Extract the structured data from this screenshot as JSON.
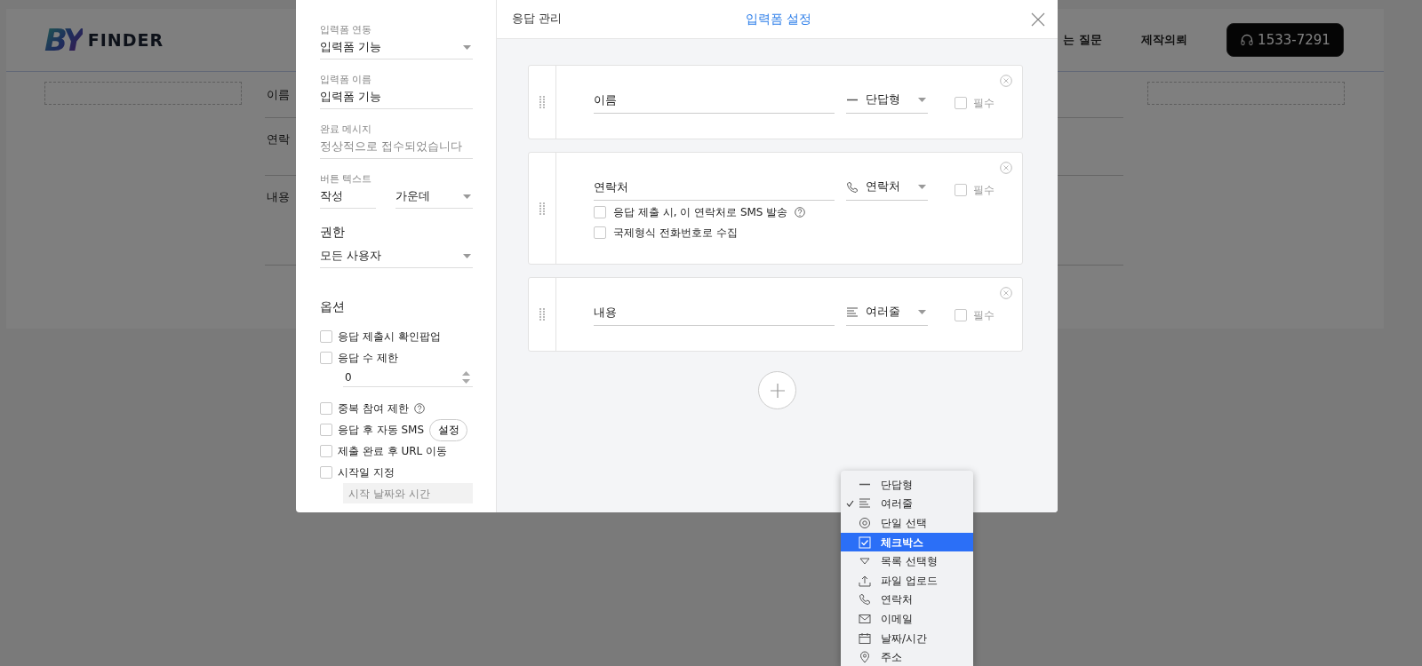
{
  "background_page": {
    "logo": {
      "mark": "BY",
      "name": "FINDER"
    },
    "nav": [
      {
        "label": "는 질문"
      },
      {
        "label": "제작의뢰"
      }
    ],
    "phone_button": "1533-7291",
    "form_labels": [
      "이름",
      "연락",
      "내용"
    ]
  },
  "modal": {
    "settings_panel": {
      "link_field": {
        "label": "입력폼 연동",
        "value": "입력폼 기능"
      },
      "name_field": {
        "label": "입력폼 이름",
        "value": "입력폼 기능"
      },
      "message_field": {
        "label": "완료 메시지",
        "placeholder": "정상적으로 접수되었습니다"
      },
      "button_text": {
        "label": "버튼 텍스트",
        "value": "작성",
        "align": "가운데"
      },
      "permission": {
        "title": "권한",
        "value": "모든 사용자"
      },
      "options_title": "옵션",
      "options": [
        {
          "kind": "plain",
          "label": "응답 제출시 확인팝업",
          "checked": false
        },
        {
          "kind": "number",
          "label": "응답 수 제한",
          "checked": false,
          "value": "0"
        },
        {
          "kind": "help",
          "label": "중복 참여 제한",
          "checked": false
        },
        {
          "kind": "button",
          "label": "응답 후 자동 SMS",
          "checked": false,
          "button": "설정"
        },
        {
          "kind": "plain",
          "label": "제출 완료 후 URL 이동",
          "checked": false
        },
        {
          "kind": "date",
          "label": "시작일 지정",
          "checked": false,
          "placeholder": "시작 날짜와 시간"
        }
      ]
    },
    "tabs": [
      {
        "label": "응답 관리",
        "selected": false
      },
      {
        "label": "입력폼 설정",
        "selected": true
      }
    ],
    "fields": [
      {
        "label": "이름",
        "kind": "short",
        "type": "단답형",
        "required": false,
        "required_label": "필수"
      },
      {
        "label": "연락처",
        "kind": "phone",
        "type": "연락처",
        "required": false,
        "required_label": "필수",
        "sub_options": [
          {
            "label": "응답 제출 시, 이 연락처로 SMS 발송",
            "help": true,
            "checked": false
          },
          {
            "label": "국제형식 전화번호로 수집",
            "help": false,
            "checked": false
          }
        ]
      },
      {
        "label": "내용",
        "kind": "long",
        "type": "여러줄",
        "required": false,
        "required_label": "필수"
      }
    ]
  },
  "type_menu": [
    {
      "kind": "short",
      "label": "단답형",
      "checked": false,
      "selected": false
    },
    {
      "kind": "long",
      "label": "여러줄",
      "checked": true,
      "selected": false
    },
    {
      "kind": "radio",
      "label": "단일 선택",
      "checked": false,
      "selected": false
    },
    {
      "kind": "checkbox",
      "label": "체크박스",
      "checked": false,
      "selected": true
    },
    {
      "kind": "select",
      "label": "목록 선택형",
      "checked": false,
      "selected": false
    },
    {
      "kind": "file",
      "label": "파일 업로드",
      "checked": false,
      "selected": false
    },
    {
      "kind": "phone",
      "label": "연락처",
      "checked": false,
      "selected": false
    },
    {
      "kind": "email",
      "label": "이메일",
      "checked": false,
      "selected": false
    },
    {
      "kind": "datetime",
      "label": "날짜/시간",
      "checked": false,
      "selected": false
    },
    {
      "kind": "address",
      "label": "주소",
      "checked": false,
      "selected": false
    }
  ]
}
